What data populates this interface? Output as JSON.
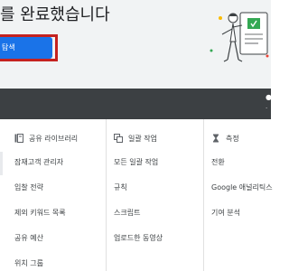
{
  "hero": {
    "title": "를 완료했습니다",
    "explore_button": "탐색"
  },
  "colors": {
    "accent_blue": "#1a73e8",
    "highlight_red": "#c5221f",
    "dark_band": "#3c4043",
    "hero_bg": "#f1f3f4"
  },
  "menu": {
    "shared_library": {
      "icon": "shared-library-icon",
      "title": "공유 라이브러리",
      "items": [
        "잠재고객 관리자",
        "입찰 전략",
        "제외 키워드 목록",
        "공유 예산",
        "위치 그룹"
      ]
    },
    "bulk_actions": {
      "icon": "bulk-actions-icon",
      "title": "일괄 작업",
      "items": [
        "모든 일괄 작업",
        "규칙",
        "스크립트",
        "업로드한 동영상"
      ]
    },
    "measurement": {
      "icon": "hourglass-icon",
      "title": "측정",
      "items": [
        "전환",
        "Google 애널리틱스",
        "기여 분석"
      ]
    }
  }
}
